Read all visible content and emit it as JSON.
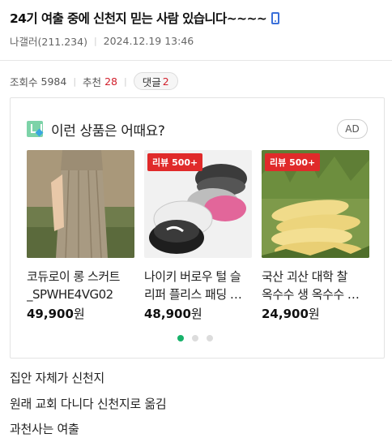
{
  "post": {
    "title": "24기 여출 중에 신천지 믿는 사람 있습니다~~~~",
    "author": "나갤러(211.234)",
    "date": "2024.12.19 13:46",
    "device_icon": "phone-icon"
  },
  "stats": {
    "views_label": "조회수",
    "views": "5984",
    "recommend_label": "추천",
    "recommend": "28",
    "comments_label": "댓글",
    "comments": "2"
  },
  "ad": {
    "title": "이런 상품은 어때요?",
    "chip": "AD",
    "logo_icon": "shopping-logo-icon",
    "products": [
      {
        "name_line1": "코듀로이 롱 스커트",
        "name_line2": "_SPWHE4VG02",
        "price": "49,900",
        "unit": "원",
        "badge": ""
      },
      {
        "name_line1": "나이키 버로우 털 슬",
        "name_line2": "리퍼 플리스 패딩 …",
        "price": "48,900",
        "unit": "원",
        "badge": "리뷰 500+"
      },
      {
        "name_line1": "국산 괴산 대학 찰",
        "name_line2": "옥수수 생 옥수수 …",
        "price": "24,900",
        "unit": "원",
        "badge": "리뷰 500+"
      }
    ],
    "pagination": {
      "total": 3,
      "active": 1
    }
  },
  "content": {
    "lines": [
      "집안 자체가 신천지",
      "원래 교회 다니다 신천지로 옮김",
      "과천사는 여출"
    ]
  },
  "colors": {
    "accent_red": "#d11e2a",
    "badge_red": "#e02a2a",
    "dot_active": "#17b26a",
    "device_icon_blue": "#3a6fd9"
  }
}
